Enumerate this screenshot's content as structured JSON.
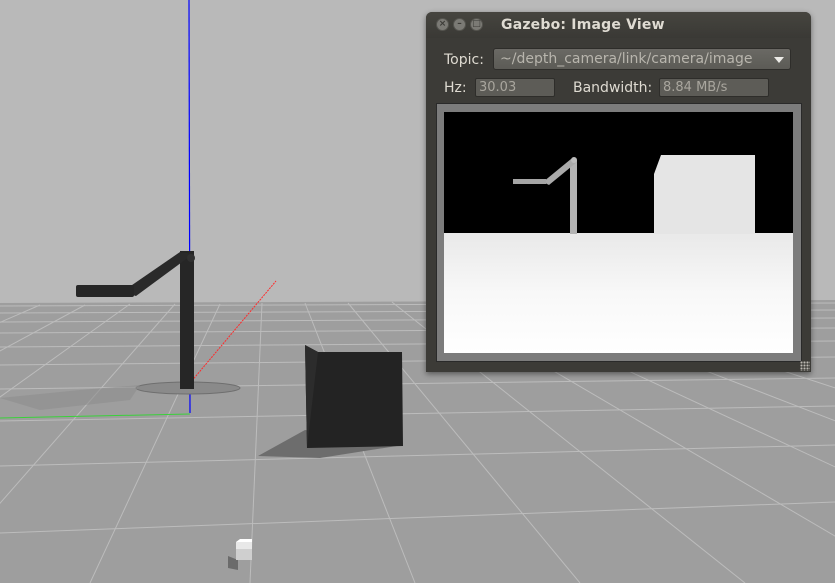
{
  "window": {
    "title": "Gazebo: Image View",
    "controls": {
      "close": "×",
      "minimize": "–",
      "maximize": "□"
    }
  },
  "topic": {
    "label": "Topic:",
    "value": "~/depth_camera/link/camera/image"
  },
  "stats": {
    "hz_label": "Hz:",
    "hz_value": "30.03",
    "bandwidth_label": "Bandwidth:",
    "bandwidth_value": "8.84 MB/s"
  },
  "colors": {
    "sky": "#b9b9b9",
    "ground": "#9e9e9e",
    "grid_line": "#bdbdbd",
    "z_axis": "#0000ff",
    "x_axis": "#ff0000",
    "y_axis": "#00ff00",
    "model": "#222222",
    "window_bg": "#3c3b37",
    "depth_far": "#000000",
    "depth_near": "#ffffff"
  }
}
